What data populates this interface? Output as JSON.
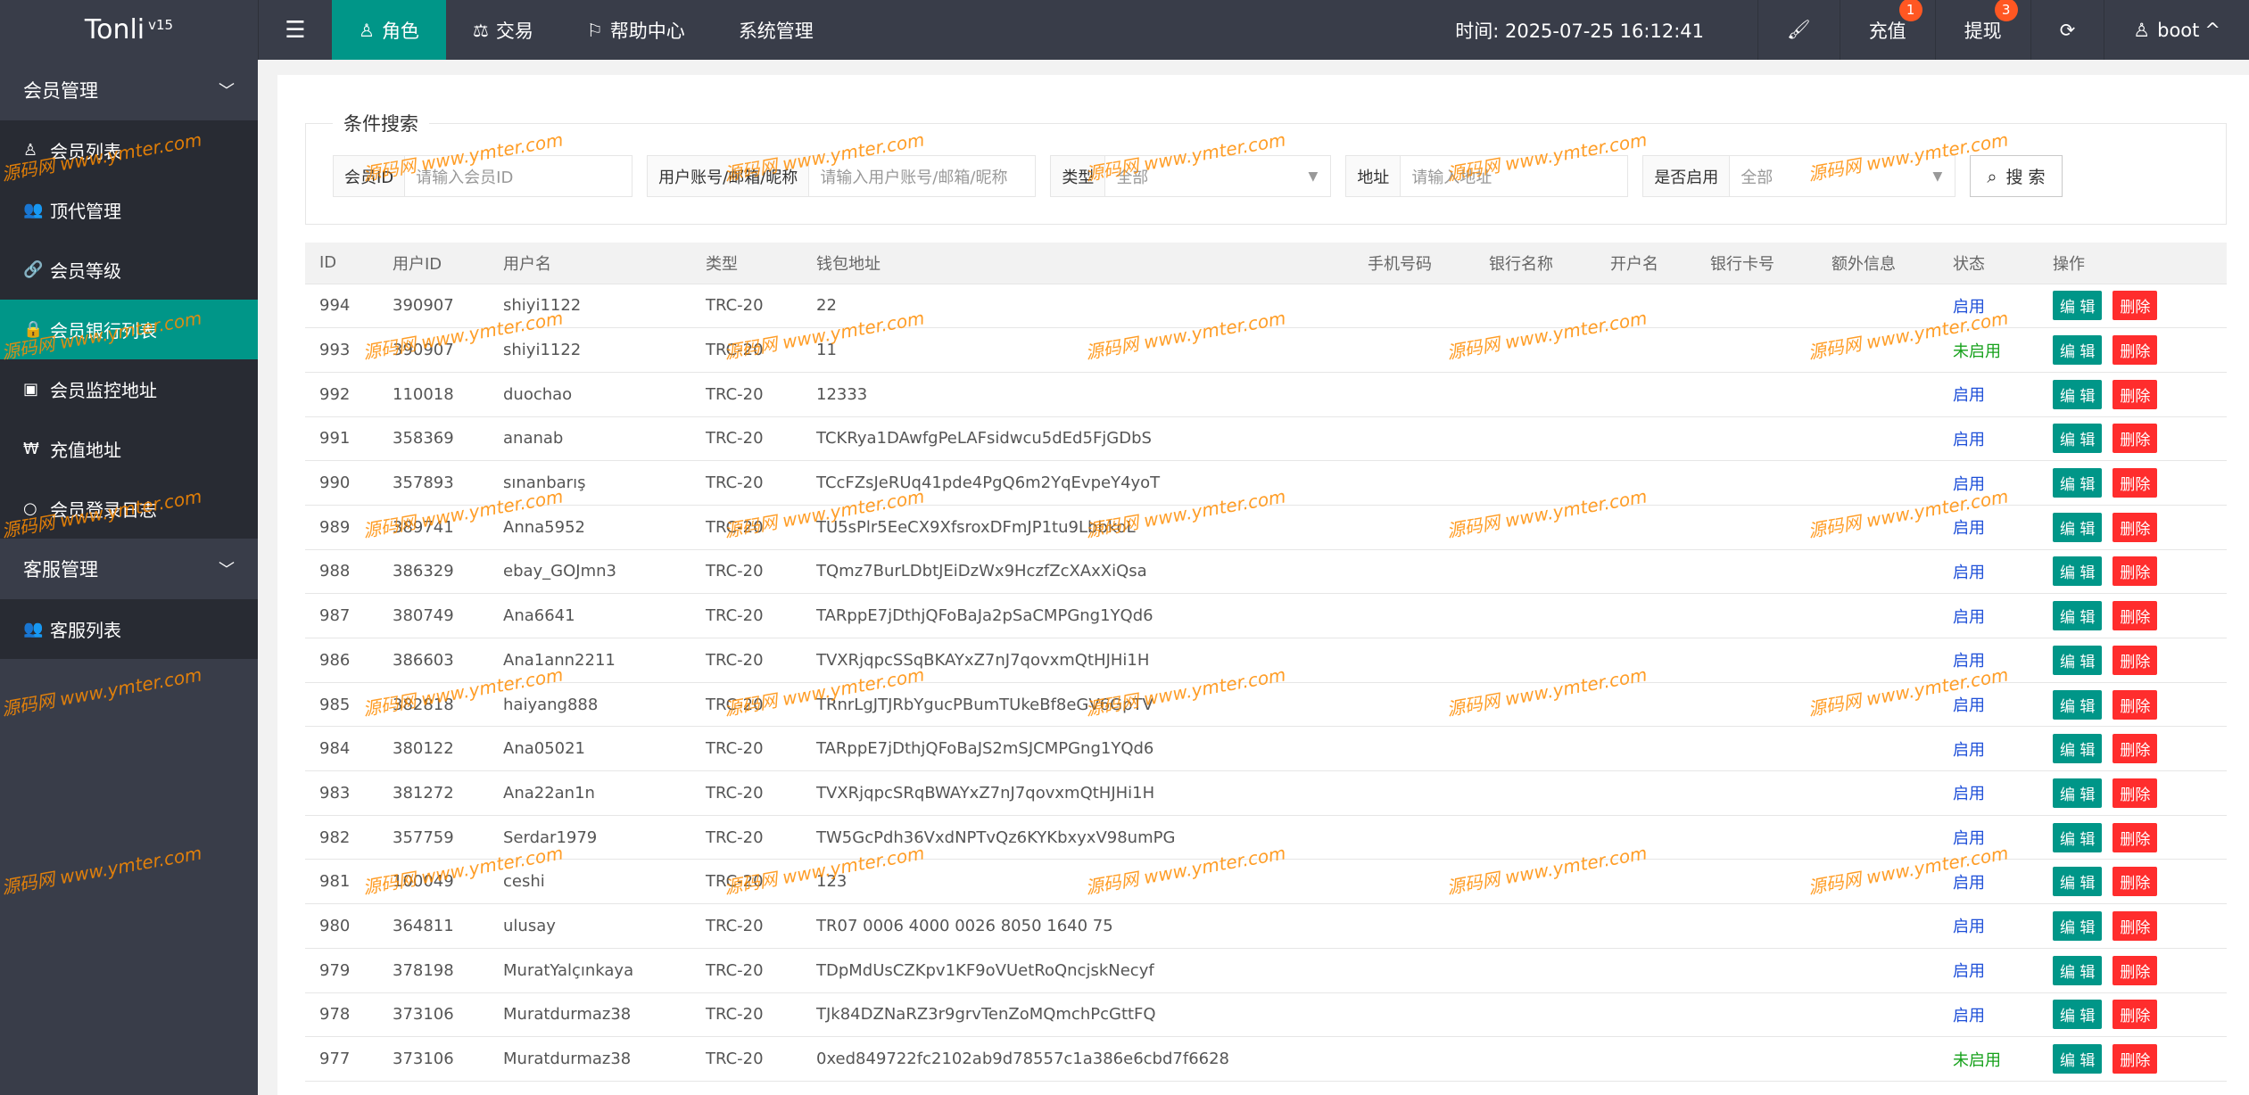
{
  "app": {
    "name": "Tonli",
    "version": "v15"
  },
  "nav": [
    {
      "label": "角色",
      "icon": "user-icon",
      "active": true
    },
    {
      "label": "交易",
      "icon": "scale-icon",
      "active": false
    },
    {
      "label": "帮助中心",
      "icon": "flag-icon",
      "active": false
    },
    {
      "label": "系统管理",
      "icon": "",
      "active": false
    }
  ],
  "header": {
    "time_label": "时间: 2025-07-25 16:12:41",
    "recharge": "充值",
    "recharge_badge": "1",
    "withdraw": "提现",
    "withdraw_badge": "3",
    "user": "boot"
  },
  "sidebar": {
    "group1": "会员管理",
    "items1": [
      {
        "label": "会员列表",
        "icon": "user-icon"
      },
      {
        "label": "顶代管理",
        "icon": "users-icon"
      },
      {
        "label": "会员等级",
        "icon": "link-icon"
      },
      {
        "label": "会员银行列表",
        "icon": "lock-icon"
      },
      {
        "label": "会员监控地址",
        "icon": "id-card-icon"
      },
      {
        "label": "充值地址",
        "icon": "won-icon"
      },
      {
        "label": "会员登录日志",
        "icon": "circle-icon"
      }
    ],
    "group2": "客服管理",
    "items2": [
      {
        "label": "客服列表",
        "icon": "users-icon"
      }
    ]
  },
  "search": {
    "legend": "条件搜索",
    "member_id_label": "会员ID",
    "member_id_placeholder": "请输入会员ID",
    "account_label": "用户账号/邮箱/昵称",
    "account_placeholder": "请输入用户账号/邮箱/昵称",
    "type_label": "类型",
    "type_value": "全部",
    "address_label": "地址",
    "address_placeholder": "请输入地址",
    "enabled_label": "是否启用",
    "enabled_value": "全部",
    "search_btn": "搜 索"
  },
  "table": {
    "headers": [
      "ID",
      "用户ID",
      "用户名",
      "类型",
      "钱包地址",
      "手机号码",
      "银行名称",
      "开户名",
      "银行卡号",
      "额外信息",
      "状态",
      "操作"
    ],
    "edit_label": "编 辑",
    "delete_label": "删除",
    "rows": [
      {
        "id": "994",
        "uid": "390907",
        "name": "shiyi1122",
        "type": "TRC-20",
        "addr": "22",
        "status": "启用"
      },
      {
        "id": "993",
        "uid": "390907",
        "name": "shiyi1122",
        "type": "TRC-20",
        "addr": "11",
        "status": "未启用"
      },
      {
        "id": "992",
        "uid": "110018",
        "name": "duochao",
        "type": "TRC-20",
        "addr": "12333",
        "status": "启用"
      },
      {
        "id": "991",
        "uid": "358369",
        "name": "ananab",
        "type": "TRC-20",
        "addr": "TCKRya1DAwfgPeLAFsidwcu5dEd5FjGDbS",
        "status": "启用"
      },
      {
        "id": "990",
        "uid": "357893",
        "name": "sınanbarış",
        "type": "TRC-20",
        "addr": "TCcFZsJeRUq41pde4PgQ6m2YqEvpeY4yoT",
        "status": "启用"
      },
      {
        "id": "989",
        "uid": "389741",
        "name": "Anna5952",
        "type": "TRC-20",
        "addr": "TU5sPlr5EeCX9XfsroxDFmJP1tu9LbbkoL",
        "status": "启用"
      },
      {
        "id": "988",
        "uid": "386329",
        "name": "ebay_GOJmn3",
        "type": "TRC-20",
        "addr": "TQmz7BurLDbtJEiDzWx9HczfZcXAxXiQsa",
        "status": "启用"
      },
      {
        "id": "987",
        "uid": "380749",
        "name": "Ana6641",
        "type": "TRC-20",
        "addr": "TARppE7jDthjQFoBaJa2pSaCMPGng1YQd6",
        "status": "启用"
      },
      {
        "id": "986",
        "uid": "386603",
        "name": "Ana1ann2211",
        "type": "TRC-20",
        "addr": "TVXRjqpcSSqBKAYxZ7nJ7qovxmQtHJHi1H",
        "status": "启用"
      },
      {
        "id": "985",
        "uid": "382818",
        "name": "haiyang888",
        "type": "TRC-20",
        "addr": "TRnrLgJTJRbYgucPBumTUkeBf8eGV6GpTV",
        "status": "启用"
      },
      {
        "id": "984",
        "uid": "380122",
        "name": "Ana05021",
        "type": "TRC-20",
        "addr": "TARppE7jDthjQFoBaJS2mSJCMPGng1YQd6",
        "status": "启用"
      },
      {
        "id": "983",
        "uid": "381272",
        "name": "Ana22an1n",
        "type": "TRC-20",
        "addr": "TVXRjqpcSRqBWAYxZ7nJ7qovxmQtHJHi1H",
        "status": "启用"
      },
      {
        "id": "982",
        "uid": "357759",
        "name": "Serdar1979",
        "type": "TRC-20",
        "addr": "TW5GcPdh36VxdNPTvQz6KYKbxyxV98umPG",
        "status": "启用"
      },
      {
        "id": "981",
        "uid": "100049",
        "name": "ceshi",
        "type": "TRC-20",
        "addr": "123",
        "status": "启用"
      },
      {
        "id": "980",
        "uid": "364811",
        "name": "ulusay",
        "type": "TRC-20",
        "addr": "TR07 0006 4000 0026 8050 1640 75",
        "status": "启用"
      },
      {
        "id": "979",
        "uid": "378198",
        "name": "MuratYalçınkaya",
        "type": "TRC-20",
        "addr": "TDpMdUsCZKpv1KF9oVUetRoQncjskNecyf",
        "status": "启用"
      },
      {
        "id": "978",
        "uid": "373106",
        "name": "Muratdurmaz38",
        "type": "TRC-20",
        "addr": "TJk84DZNaRZ3r9grvTenZoMQmchPcGttFQ",
        "status": "启用"
      },
      {
        "id": "977",
        "uid": "373106",
        "name": "Muratdurmaz38",
        "type": "TRC-20",
        "addr": "0xed849722fc2102ab9d78557c1a386e6cbd7f6628",
        "status": "未启用"
      }
    ]
  },
  "watermark": {
    "text": "源码网 www.ymter.com"
  },
  "colors": {
    "accent": "#009688",
    "dark": "#393d49",
    "danger": "#ff2d2d",
    "enabled": "#1e4fd8",
    "disabled": "#16a11b"
  }
}
